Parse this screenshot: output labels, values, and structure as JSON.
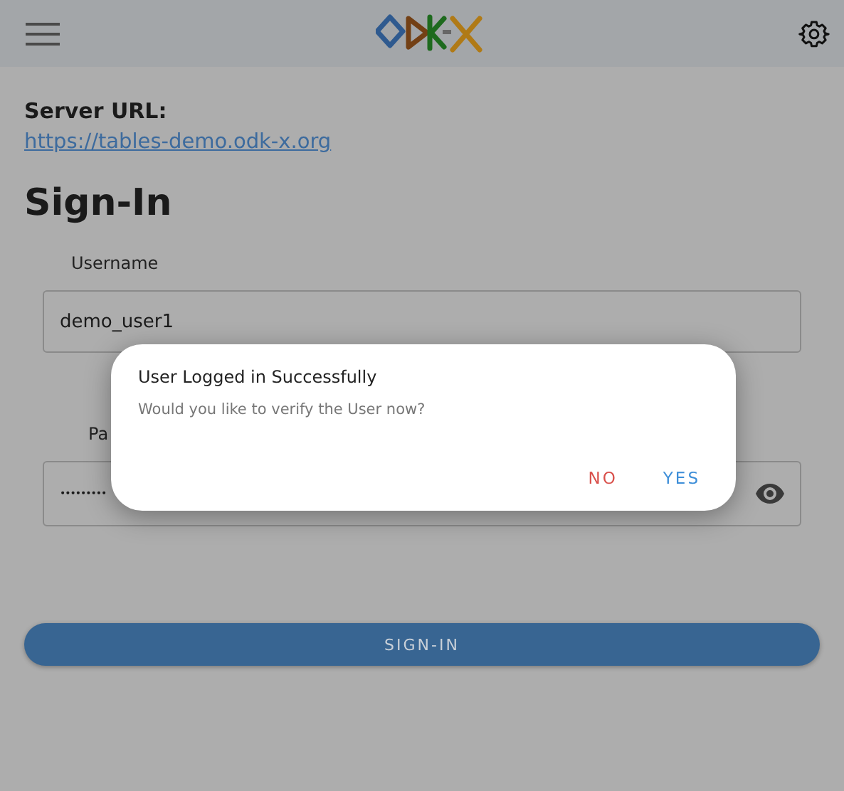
{
  "server": {
    "label": "Server URL:",
    "url": "https://tables-demo.odk-x.org"
  },
  "title": "Sign-In",
  "username": {
    "label": "Username",
    "value": "demo_user1"
  },
  "password": {
    "label": "Pa",
    "value": "•••••••••"
  },
  "sign_in_button": "SIGN-IN",
  "dialog": {
    "title": "User Logged in Successfully",
    "message": "Would you like to verify the User now?",
    "buttons": [
      {
        "label": "NO",
        "kind": "negative"
      },
      {
        "label": "YES",
        "kind": "positive"
      }
    ]
  }
}
